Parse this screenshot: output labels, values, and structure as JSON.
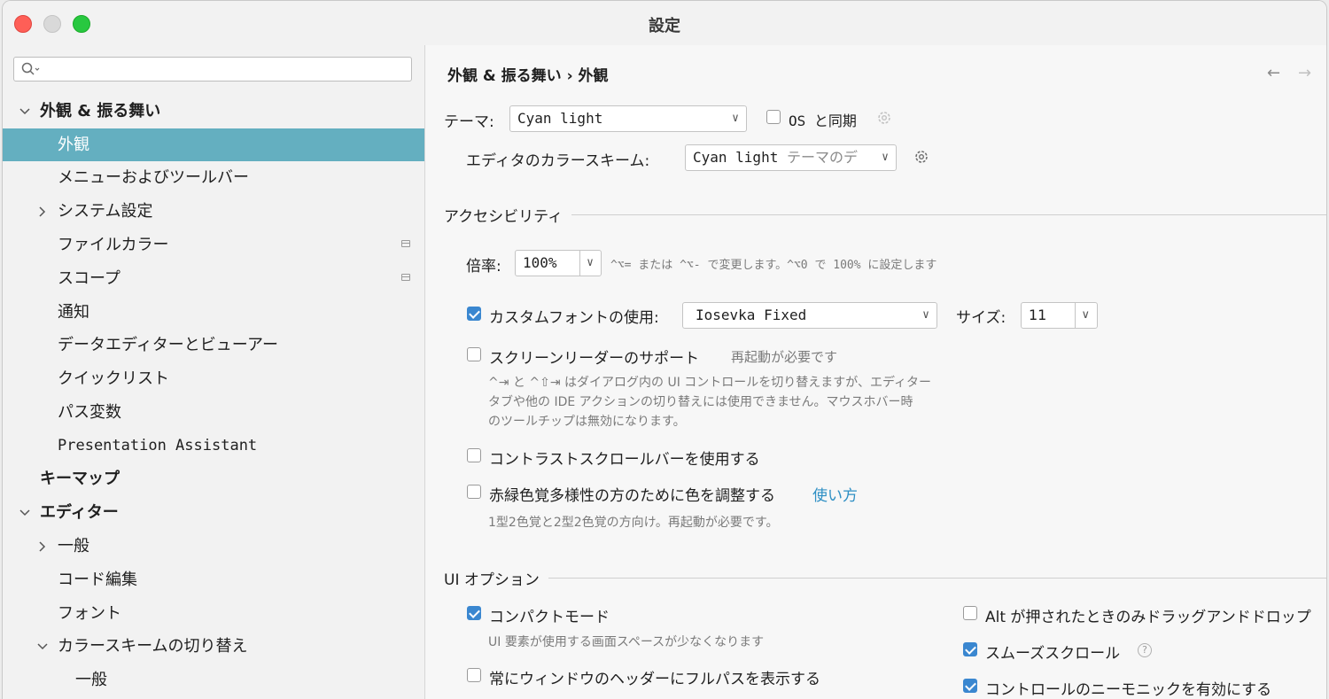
{
  "window": {
    "title": "設定"
  },
  "sidebar": {
    "items": [
      {
        "label": "外観 & 振る舞い"
      },
      {
        "label": "外観"
      },
      {
        "label": "メニューおよびツールバー"
      },
      {
        "label": "システム設定"
      },
      {
        "label": "ファイルカラー"
      },
      {
        "label": "スコープ"
      },
      {
        "label": "通知"
      },
      {
        "label": "データエディターとビューアー"
      },
      {
        "label": "クイックリスト"
      },
      {
        "label": "パス変数"
      },
      {
        "label": "Presentation Assistant"
      },
      {
        "label": "キーマップ"
      },
      {
        "label": "エディター"
      },
      {
        "label": "一般"
      },
      {
        "label": "コード編集"
      },
      {
        "label": "フォント"
      },
      {
        "label": "カラースキームの切り替え"
      },
      {
        "label": "一般"
      }
    ]
  },
  "main": {
    "breadcrumb": "外観 & 振る舞い › 外観",
    "theme_label": "テーマ:",
    "theme_value": "Cyan light",
    "os_sync_label": "OS と同期",
    "scheme_label": "エディタのカラースキーム:",
    "scheme_value": "Cyan light",
    "scheme_suffix": "テーマのデ",
    "accessibility": {
      "heading": "アクセシビリティ",
      "zoom_label": "倍率:",
      "zoom_value": "100%",
      "zoom_hint": "^⌥= または ^⌥- で変更します。^⌥0 で 100% に設定します",
      "custom_font_label": "カスタムフォントの使用:",
      "custom_font_value": "Iosevka Fixed",
      "size_label": "サイズ:",
      "size_value": "11",
      "screen_reader_label": "スクリーンリーダーのサポート",
      "screen_reader_hint": "再起動が必要です",
      "screen_reader_desc": [
        "^⇥ と ^⇧⇥ はダイアログ内の UI コントロールを切り替えますが、エディター",
        "タブや他の IDE アクションの切り替えには使用できません。マウスホバー時",
        "のツールチップは無効になります。"
      ],
      "contrast_label": "コントラストスクロールバーを使用する",
      "color_label": "赤緑色覚多様性の方のために色を調整する",
      "color_link": "使い方",
      "color_hint": "1型2色覚と2型2色覚の方向け。再起動が必要です。"
    },
    "ui_options": {
      "heading": "UI オプション",
      "compact_label": "コンパクトモード",
      "compact_hint": "UI 要素が使用する画面スペースが少なくなります",
      "fullpath_label": "常にウィンドウのヘッダーにフルパスを表示する",
      "alt_drag_label": "Alt が押されたときのみドラッグアンドドロップ",
      "smooth_label": "スムーズスクロール",
      "mnemonic_label": "コントロールのニーモニックを有効にする"
    }
  },
  "colors": {
    "selection": "#64afc0",
    "accent": "#3a87d0",
    "link": "#2e8fc4"
  }
}
